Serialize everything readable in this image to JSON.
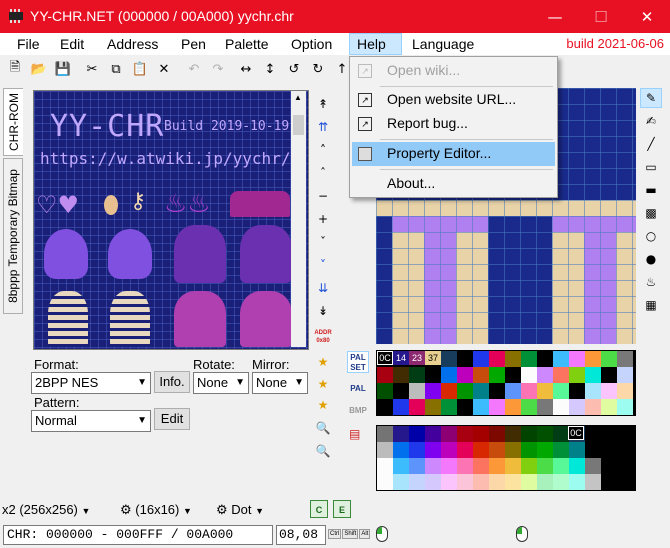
{
  "window": {
    "title": "YY-CHR.NET (000000 / 00A000) yychr.chr",
    "minimize_icon": "minimize-icon",
    "maximize_icon": "maximize-icon",
    "close_icon": "close-icon",
    "accent": "#e81123"
  },
  "menubar": {
    "items": [
      "File",
      "Edit",
      "Address",
      "Pen",
      "Palette",
      "Option",
      "Help",
      "Language"
    ],
    "active": "Help",
    "build": "build 2021-06-06"
  },
  "help_menu": {
    "items": [
      {
        "label": "Open wiki...",
        "enabled": false,
        "icon": "wiki-icon"
      },
      {
        "label": "Open website URL...",
        "enabled": true,
        "icon": "link-icon"
      },
      {
        "label": "Report bug...",
        "enabled": true,
        "icon": "link-icon"
      },
      {
        "label": "Property Editor...",
        "enabled": true,
        "icon": "property-icon",
        "highlighted": true
      },
      {
        "label": "About...",
        "enabled": true,
        "icon": ""
      }
    ]
  },
  "side_tabs": [
    "CHR-ROM",
    "8bppp Temporary Bitmap"
  ],
  "canvas": {
    "banner_title": "YY-CHR",
    "banner_build": "Build 2019-10-19",
    "url_text": "https://w.atwiki.jp/yychr/"
  },
  "format": {
    "label": "Format:",
    "value": "2BPP NES",
    "info_button": "Info.",
    "rotate_label": "Rotate:",
    "rotate_value": "None",
    "mirror_label": "Mirror:",
    "mirror_value": "None",
    "pattern_label": "Pattern:",
    "pattern_value": "Normal",
    "edit_button": "Edit"
  },
  "nav_strip": {
    "addr_label": "ADDR",
    "addr_value": "0x80"
  },
  "palette": {
    "palset_label": "PAL SET",
    "pal_label": "PAL",
    "bmp_label": "BMP",
    "selected_indices": [
      "0C",
      "14",
      "23",
      "37"
    ],
    "big_selected": "0C",
    "colors": [
      "#747474",
      "#24188c",
      "#0000a8",
      "#44009c",
      "#8c0074",
      "#a80010",
      "#a40000",
      "#7c0800",
      "#402c00",
      "#004400",
      "#005000",
      "#003c14",
      "#183c5c",
      "#000000",
      "#000000",
      "#000000",
      "#bcbcbc",
      "#0070ec",
      "#2038ec",
      "#8000f0",
      "#bc00bc",
      "#e40058",
      "#d82800",
      "#c84c0c",
      "#887000",
      "#009400",
      "#00a800",
      "#009038",
      "#008088",
      "#000000",
      "#000000",
      "#000000",
      "#fcfcfc",
      "#3cbcfc",
      "#5c94fc",
      "#cc88fc",
      "#f478fc",
      "#fc74b4",
      "#fc7460",
      "#fc9838",
      "#f0bc3c",
      "#80d010",
      "#4cdc48",
      "#58f898",
      "#00e8d8",
      "#787878",
      "#000000",
      "#000000",
      "#fcfcfc",
      "#a8e4fc",
      "#c4d4fc",
      "#d4c8fc",
      "#fcc4fc",
      "#fcc4d8",
      "#fcbcb0",
      "#fcd8a8",
      "#fce4a0",
      "#e0fca0",
      "#a8f0bc",
      "#b0fccc",
      "#9cfcf0",
      "#c4c4c4",
      "#000000",
      "#000000"
    ]
  },
  "bottom_bar": {
    "zoom": "x2 (256x256)",
    "grid": "(16x16)",
    "pen": "Dot"
  },
  "status": {
    "chr": "CHR: 000000 - 000FFF / 00A000",
    "pos": "08,08",
    "keys": [
      "Ctrl",
      "Shift",
      "Alt"
    ]
  }
}
